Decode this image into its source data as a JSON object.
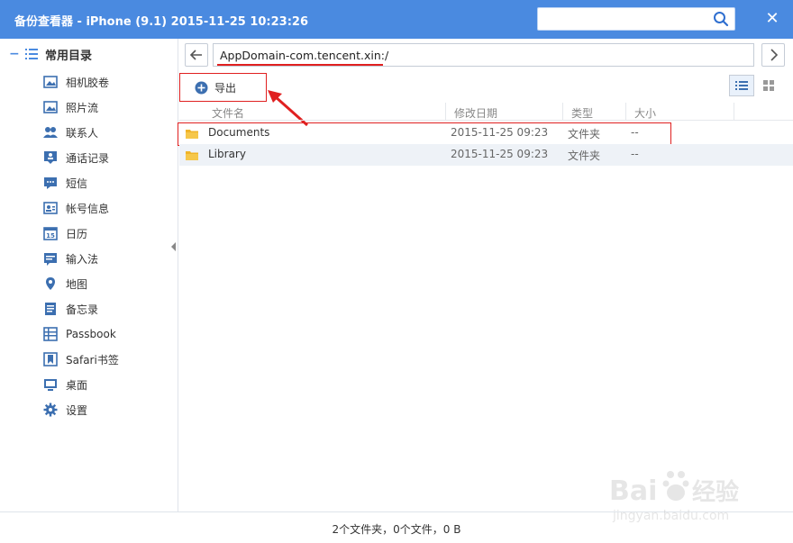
{
  "window": {
    "title": "备份查看器 - iPhone (9.1) 2015-11-25 10:23:26"
  },
  "search": {
    "placeholder": ""
  },
  "sidebar": {
    "category_label": "常用目录",
    "items": [
      {
        "label": "相机胶卷",
        "icon": "photo-icon"
      },
      {
        "label": "照片流",
        "icon": "photo-stream-icon"
      },
      {
        "label": "联系人",
        "icon": "contacts-icon"
      },
      {
        "label": "通话记录",
        "icon": "call-log-icon"
      },
      {
        "label": "短信",
        "icon": "sms-icon"
      },
      {
        "label": "帐号信息",
        "icon": "account-icon"
      },
      {
        "label": "日历",
        "icon": "calendar-icon"
      },
      {
        "label": "输入法",
        "icon": "input-method-icon"
      },
      {
        "label": "地图",
        "icon": "map-pin-icon"
      },
      {
        "label": "备忘录",
        "icon": "notes-icon"
      },
      {
        "label": "Passbook",
        "icon": "passbook-icon"
      },
      {
        "label": "Safari书签",
        "icon": "bookmark-icon"
      },
      {
        "label": "桌面",
        "icon": "desktop-icon"
      },
      {
        "label": "设置",
        "icon": "gear-icon"
      }
    ]
  },
  "path": {
    "value": "AppDomain-com.tencent.xin:/"
  },
  "toolbar": {
    "export_label": "导出"
  },
  "table": {
    "columns": [
      "文件名",
      "修改日期",
      "类型",
      "大小"
    ],
    "rows": [
      {
        "name": "Documents",
        "modified": "2015-11-25 09:23",
        "type": "文件夹",
        "size": "--"
      },
      {
        "name": "Library",
        "modified": "2015-11-25 09:23",
        "type": "文件夹",
        "size": "--"
      }
    ]
  },
  "status": {
    "text": "2个文件夹，0个文件，0 B"
  },
  "watermark": {
    "brand": "Bai du 经验",
    "url": "jingyan.baidu.com"
  },
  "colors": {
    "titlebar": "#4a8ae0",
    "accent": "#4a8ae0",
    "annotation": "#e02020",
    "folder": "#f0b429"
  }
}
